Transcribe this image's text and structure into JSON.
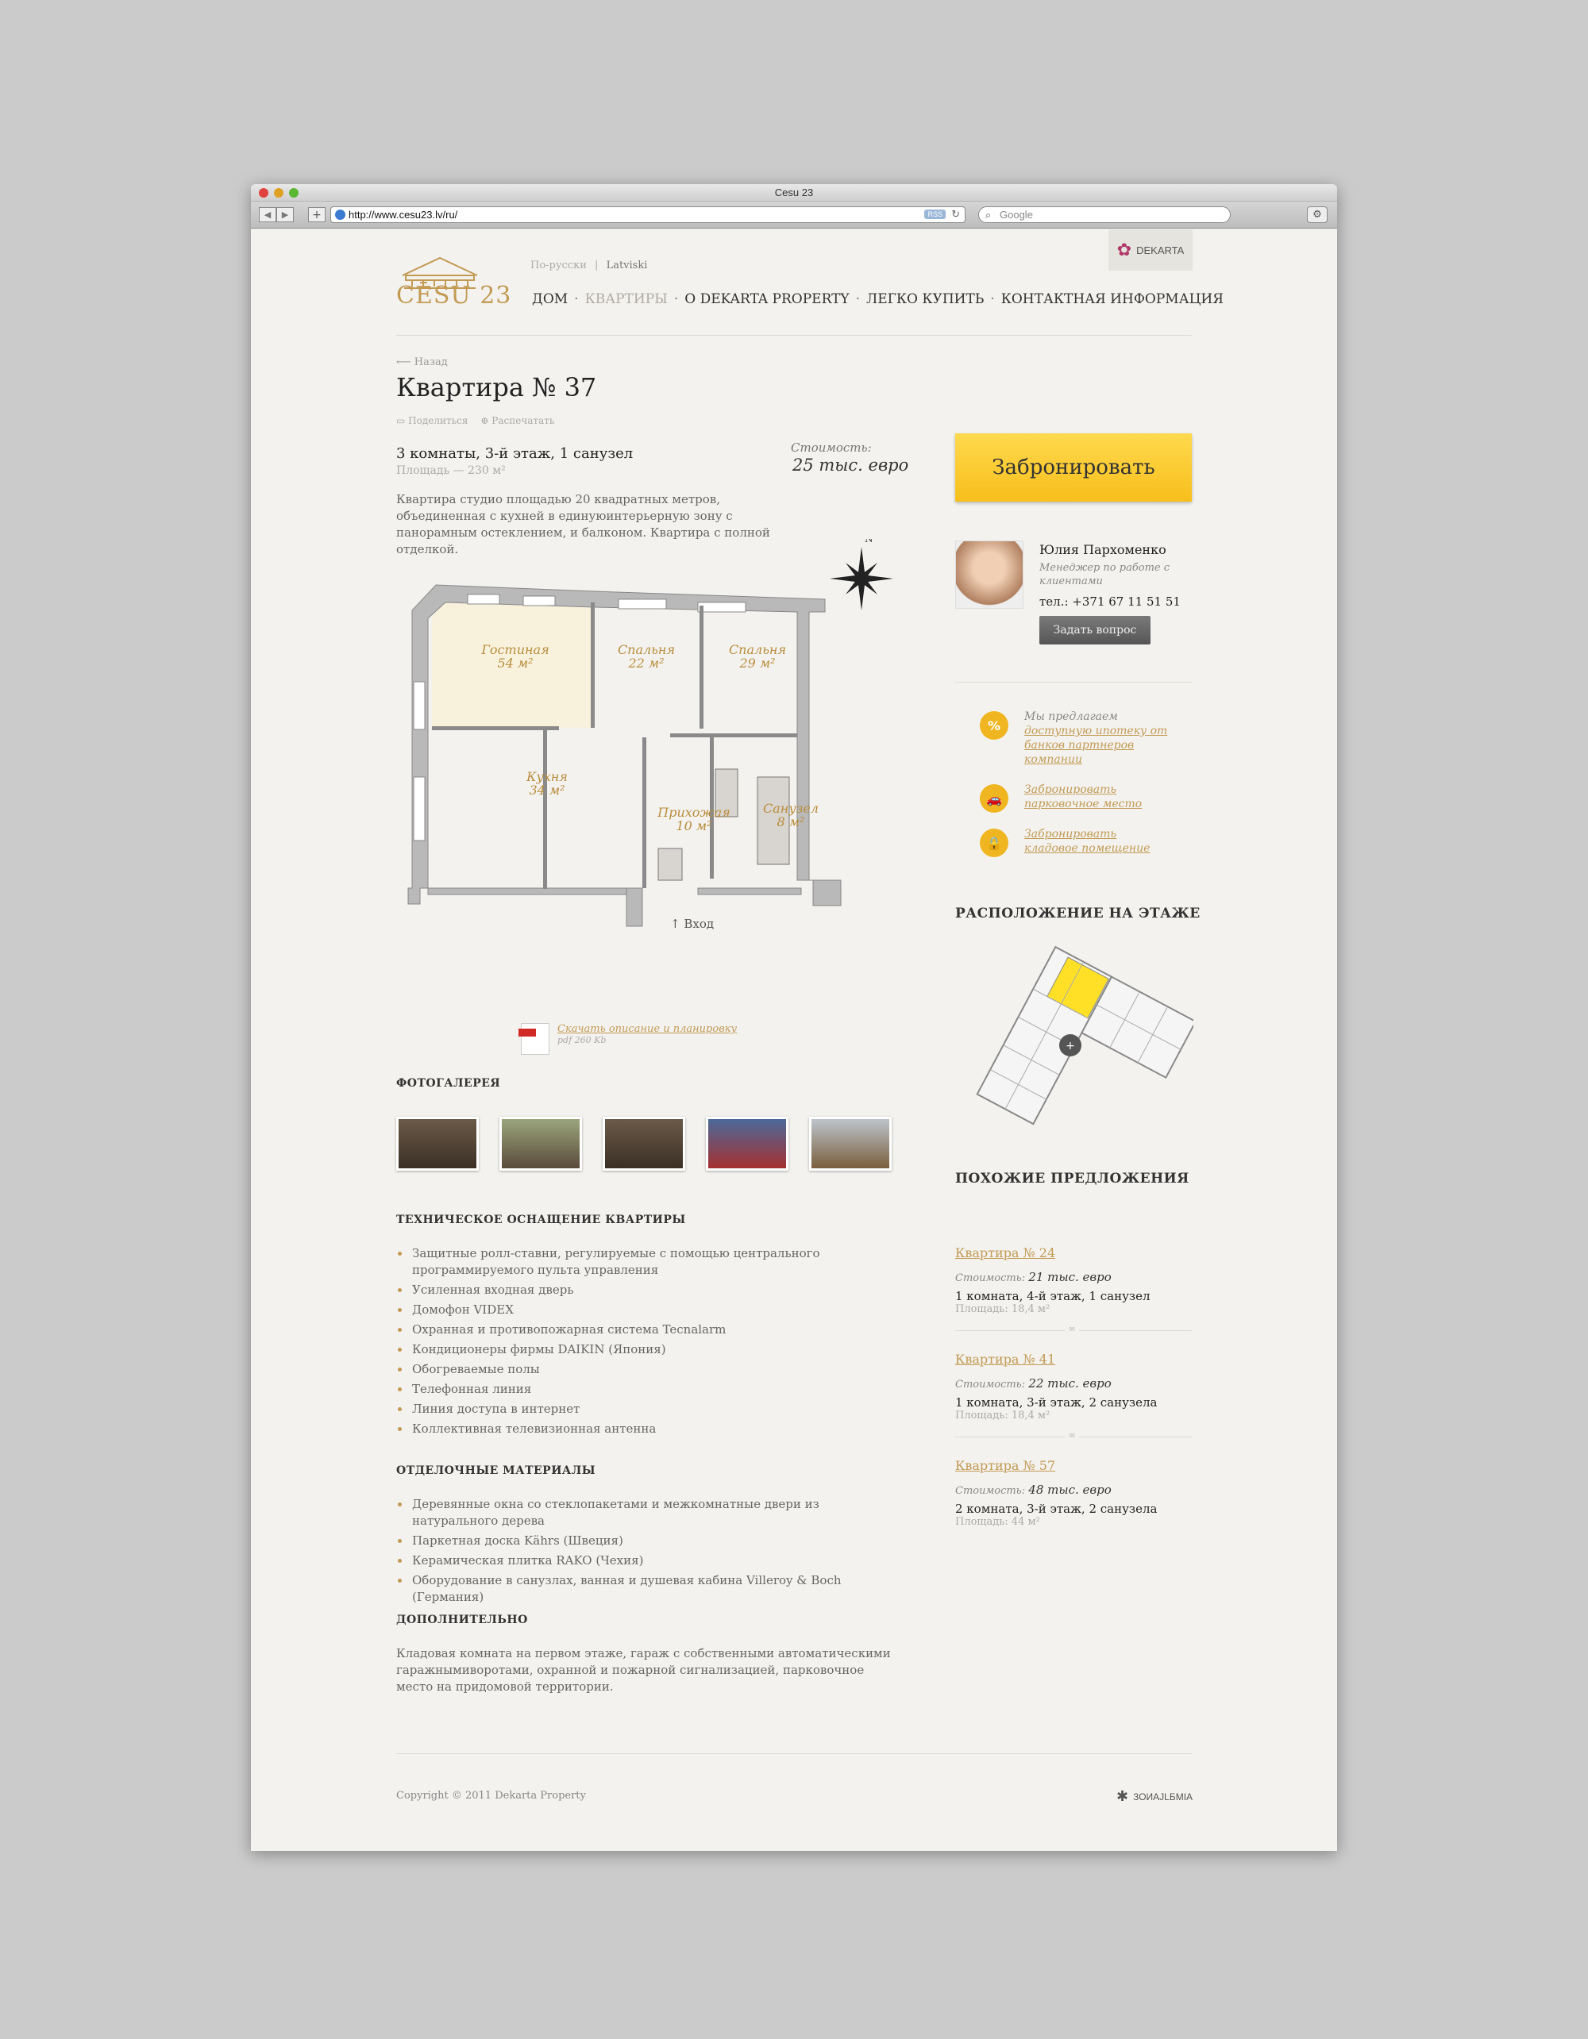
{
  "browser": {
    "title": "Cesu 23",
    "url": "http://www.cesu23.lv/ru/",
    "rss": "RSS",
    "search_placeholder": "Google"
  },
  "header": {
    "logo_text": "CĒSU 23",
    "lang_ru": "По-русски",
    "lang_lv": "Latviski",
    "partner": "DEKARTA",
    "nav": [
      "ДОМ",
      "КВАРТИРЫ",
      "О DEKARTA PROPERTY",
      "ЛЕГКО КУПИТЬ",
      "КОНТАКТНАЯ ИНФОРМАЦИЯ"
    ]
  },
  "apartment": {
    "back": "Назад",
    "title": "Квартира № 37",
    "share": "Поделиться",
    "print": "Распечатать",
    "specs": "3 комнаты, 3-й этаж, 1 санузел",
    "area": "Площадь — 230 м²",
    "price_label": "Стоимость:",
    "price": "25 тыс. евро",
    "description": "Квартира студио площадью 20 квадратных метров, объединенная с кухней в единуюинтерьерную зону с панорамным остеклением, и балконом. Квартира с полной отделкой.",
    "rooms": [
      {
        "name": "Гостиная",
        "size": "54 м²"
      },
      {
        "name": "Спальня",
        "size": "22 м²"
      },
      {
        "name": "Спальня",
        "size": "29 м²"
      },
      {
        "name": "Кухня",
        "size": "34 м²"
      },
      {
        "name": "Прихожая",
        "size": "10 м²"
      },
      {
        "name": "Санузел",
        "size": "8 м²"
      }
    ],
    "entrance": "Вход",
    "compass": "N",
    "pdf_link": "Скачать описание и планировку",
    "pdf_size": "pdf 260 Kb"
  },
  "gallery": {
    "title": "ФОТОГАЛЕРЕЯ",
    "thumb_colors": [
      "#6b5a48",
      "#7a7560",
      "#6b5a48",
      "#4b6a9a",
      "#8a7250"
    ]
  },
  "equipment": {
    "title": "ТЕХНИЧЕСКОЕ ОСНАЩЕНИЕ КВАРТИРЫ",
    "items": [
      "Защитные ролл-ставни, регулируемые с помощью центрального программируемого пульта управления",
      "Усиленная входная дверь",
      "Домофон VIDEX",
      "Охранная и противопожарная система Tecnalarm",
      "Кондиционеры фирмы DAIKIN (Япония)",
      "Обогреваемые полы",
      "Телефонная линия",
      "Линия доступа в интернет",
      "Коллективная телевизионная антенна"
    ]
  },
  "materials": {
    "title": "ОТДЕЛОЧНЫЕ МАТЕРИАЛЫ",
    "items": [
      "Деревянные окна со стеклопакетами и межкомнатные двери из натурального дерева",
      "Паркетная доска Kährs (Швеция)",
      "Керамическая плитка RAKO (Чехия)",
      "Оборудование в санузлах, ванная и душевая кабина Villeroy & Boch (Германия)"
    ]
  },
  "extra": {
    "title": "ДОПОЛНИТЕЛЬНО",
    "text": "Кладовая комната на первом этаже, гараж с собственными автоматическими гаражнымиворотами, охранной и пожарной сигнализацией, парковочное место на придомовой территории."
  },
  "sidebar": {
    "book_button": "Забронировать",
    "agent_name": "Юлия Пархоменко",
    "agent_role": "Менеджер по работе с клиентами",
    "agent_phone": "тел.: +371 67 11 51 51",
    "ask_button": "Задать вопрос",
    "offers": [
      {
        "icon": "%",
        "prefix": "Мы предлагаем",
        "link": "доступную ипотеку от банков партнеров компании"
      },
      {
        "icon": "🚗",
        "prefix": "",
        "link": "Забронировать парковочное место"
      },
      {
        "icon": "🔒",
        "prefix": "",
        "link": "Забронировать кладовое помещение"
      }
    ],
    "floor_title": "РАСПОЛОЖЕНИЕ НА ЭТАЖЕ",
    "similar_title": "ПОХОЖИЕ ПРЕДЛОЖЕНИЯ",
    "similar": [
      {
        "title": "Квартира № 24",
        "price_label": "Стоимость:",
        "price": "21 тыс. евро",
        "specs": "1 комната, 4-й этаж, 1 санузел",
        "area": "Площадь: 18,4 м²"
      },
      {
        "title": "Квартира № 41",
        "price_label": "Стоимость:",
        "price": "22 тыс. евро",
        "specs": "1 комната, 3-й этаж, 2 санузела",
        "area": "Площадь: 18,4 м²"
      },
      {
        "title": "Квартира № 57",
        "price_label": "Стоимость:",
        "price": "48 тыс. евро",
        "specs": "2 комната, 3-й этаж, 2 санузела",
        "area": "Площадь: 44 м²"
      }
    ]
  },
  "footer": {
    "copyright": "Copyright © 2011 Dekarta Property",
    "brand": "ЗОИАJLБМIA"
  },
  "colors": {
    "accent": "#c29a54",
    "button_yellow": "#f7bf1b",
    "highlight": "#ffe027"
  }
}
